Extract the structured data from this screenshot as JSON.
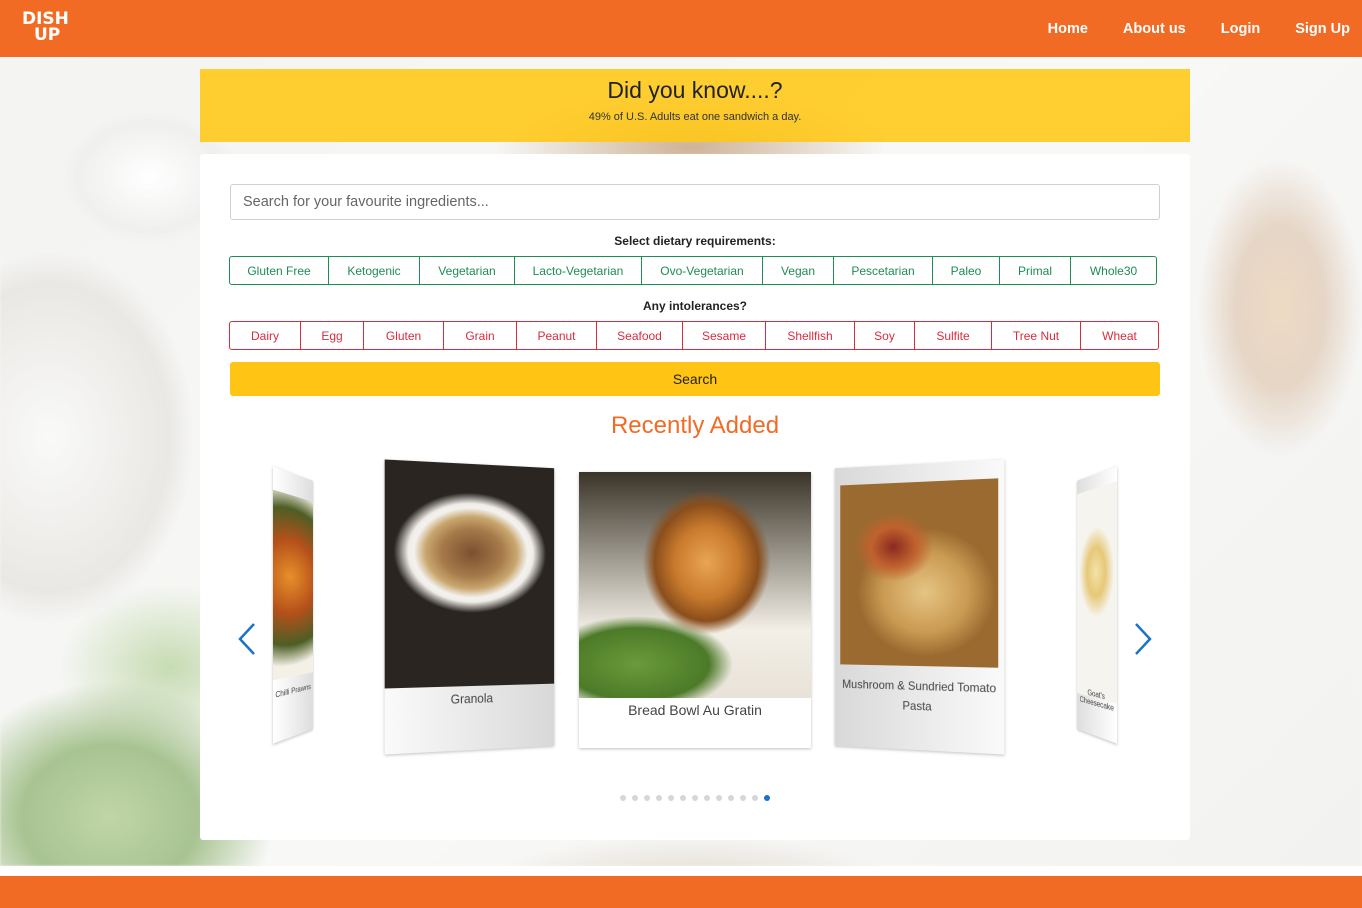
{
  "nav": {
    "logo_line1": "DISH",
    "logo_line2": "UP",
    "links": [
      "Home",
      "About us",
      "Login",
      "Sign Up"
    ]
  },
  "banner": {
    "title": "Did you know....?",
    "fact": "49% of U.S. Adults eat one sandwich a day."
  },
  "search": {
    "placeholder": "Search for your favourite ingredients...",
    "button_label": "Search"
  },
  "dietary": {
    "label": "Select dietary requirements:",
    "options": [
      "Gluten Free",
      "Ketogenic",
      "Vegetarian",
      "Lacto-Vegetarian",
      "Ovo-Vegetarian",
      "Vegan",
      "Pescetarian",
      "Paleo",
      "Primal",
      "Whole30"
    ]
  },
  "intolerances": {
    "label": "Any intolerances?",
    "options": [
      "Dairy",
      "Egg",
      "Gluten",
      "Grain",
      "Peanut",
      "Seafood",
      "Sesame",
      "Shellfish",
      "Soy",
      "Sulfite",
      "Tree Nut",
      "Wheat"
    ]
  },
  "recent": {
    "title": "Recently Added",
    "slides": [
      {
        "caption": "Chilli Prawns"
      },
      {
        "caption": "Granola"
      },
      {
        "caption": "Bread Bowl Au Gratin"
      },
      {
        "caption": "Mushroom & Sundried Tomato Pasta"
      },
      {
        "caption": "Goat's Cheesecake"
      }
    ],
    "dot_count": 13,
    "active_dot": 13
  },
  "colors": {
    "brand_orange": "#f26b25",
    "banner_yellow": "#ffc414",
    "diet_green": "#1e8c55",
    "intolerance_red": "#d92b3d",
    "carousel_blue": "#1a73c8"
  }
}
